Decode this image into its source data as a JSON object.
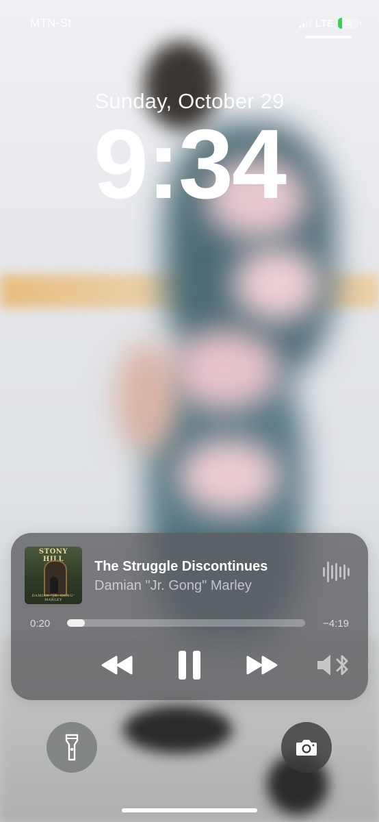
{
  "status_bar": {
    "carrier": "MTN-St",
    "network": "LTE",
    "battery_level": "21",
    "battery_fraction": 0.21,
    "battery_color": "#3ecf5b",
    "signal_bars_active": 2,
    "signal_bars_total": 4
  },
  "lock_screen": {
    "date": "Sunday, October 29",
    "time": "9:34"
  },
  "now_playing": {
    "album_title": "STONY HILL",
    "album_footer": "DAMIAN \"JR. GONG\" MARLEY",
    "song_title": "The Struggle Discontinues",
    "artist": "Damian \"Jr. Gong\" Marley",
    "elapsed": "0:20",
    "remaining": "−4:19",
    "progress_fraction": 0.074,
    "controls": {
      "rewind_icon": "rewind-icon",
      "pause_icon": "pause-icon",
      "fast_forward_icon": "fast-forward-icon",
      "audio_output_icon": "bluetooth-speaker-icon",
      "airplay_icon": "audio-waveform-icon"
    }
  },
  "quick_actions": {
    "flashlight_icon": "flashlight-icon",
    "camera_icon": "camera-icon"
  }
}
